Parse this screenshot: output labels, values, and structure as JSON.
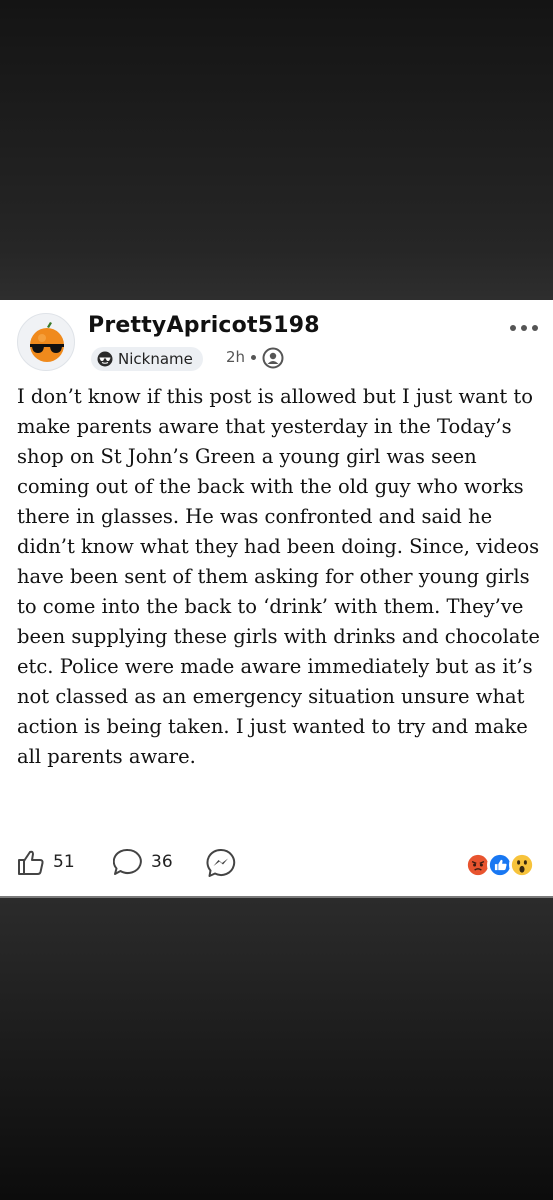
{
  "post": {
    "author": "PrettyApricot5198",
    "badge_label": "Nickname",
    "timestamp": "2h",
    "body": "I don’t know if this post is allowed but I just want to make parents aware that yesterday in the Today’s shop on St John’s Green a young girl was seen coming out of the back with the old guy who works there in glasses. He was confronted and said he didn’t know what they had been doing. Since, videos have been sent of them asking for other young girls to come into the back to ‘drink’ with them. They’ve been supplying these girls with drinks and chocolate etc. Police were made aware immediately but as it’s not classed as an emergency situation unsure what action is being taken. I just wanted to try and make all parents aware."
  },
  "actions": {
    "like_count": "51",
    "comment_count": "36"
  },
  "icons": {
    "avatar": "orange-with-sunglasses",
    "badge": "sunglasses-emoji",
    "more": "more-dots-icon",
    "audience": "group-icon",
    "like": "thumbs-up-icon",
    "comment": "comment-bubble-icon",
    "share": "messenger-icon",
    "reactions": [
      "angry",
      "like",
      "wow"
    ]
  },
  "colors": {
    "like_blue": "#1877f2",
    "angry_red": "#e8542f",
    "wow_yellow": "#f7c33b"
  }
}
